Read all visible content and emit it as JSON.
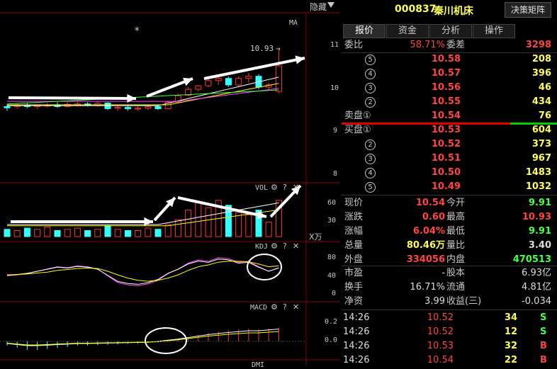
{
  "topbar": {
    "hide_label": "隐藏"
  },
  "header": {
    "code": "000837",
    "name": "秦川机床",
    "decision_button": "决策矩阵"
  },
  "tabs": [
    {
      "label": "报价",
      "active": true
    },
    {
      "label": "资金",
      "active": false
    },
    {
      "label": "分析",
      "active": false
    },
    {
      "label": "操作",
      "active": false
    }
  ],
  "weibi": {
    "label1": "委比",
    "pct": "58.71%",
    "label2": "委差",
    "diff": "3298"
  },
  "sell": [
    {
      "level": "⑤",
      "price": "10.58",
      "vol": "208"
    },
    {
      "level": "④",
      "price": "10.57",
      "vol": "396"
    },
    {
      "level": "③",
      "price": "10.56",
      "vol": "46"
    },
    {
      "level": "②",
      "price": "10.55",
      "vol": "434"
    },
    {
      "level": "卖盘①",
      "price": "10.54",
      "vol": "76"
    }
  ],
  "buy": [
    {
      "level": "买盘①",
      "price": "10.53",
      "vol": "604"
    },
    {
      "level": "②",
      "price": "10.52",
      "vol": "373"
    },
    {
      "level": "③",
      "price": "10.51",
      "vol": "967"
    },
    {
      "level": "④",
      "price": "10.50",
      "vol": "1483"
    },
    {
      "level": "⑤",
      "price": "10.49",
      "vol": "1032"
    }
  ],
  "quote": [
    {
      "l1": "现价",
      "v1": "10.54",
      "c1": "red",
      "l2": "今开",
      "v2": "9.91",
      "c2": "grn"
    },
    {
      "l1": "涨跌",
      "v1": "0.60",
      "c1": "red",
      "l2": "最高",
      "v2": "10.93",
      "c2": "red"
    },
    {
      "l1": "涨幅",
      "v1": "6.04%",
      "c1": "red",
      "l2": "最低",
      "v2": "9.91",
      "c2": "grn"
    },
    {
      "l1": "总量",
      "v1": "80.46万",
      "c1": "yel",
      "l2": "量比",
      "v2": "3.40",
      "c2": "wht"
    },
    {
      "l1": "外盘",
      "v1": "334056",
      "c1": "red",
      "l2": "内盘",
      "v2": "470513",
      "c2": "grn"
    }
  ],
  "fundamentals": [
    {
      "l1": "市盈",
      "v1": "-",
      "l2": "股本",
      "v2": "6.93亿"
    },
    {
      "l1": "换手",
      "v1": "16.71%",
      "l2": "流通",
      "v2": "4.81亿"
    },
    {
      "l1": "净资",
      "v1": "3.99",
      "l2": "收益(三)",
      "v2": "-0.034"
    }
  ],
  "ticks": [
    {
      "time": "14:26",
      "price": "10.52",
      "vol": "34",
      "side": "S"
    },
    {
      "time": "14:26",
      "price": "10.52",
      "vol": "12",
      "side": "S"
    },
    {
      "time": "14:26",
      "price": "10.53",
      "vol": "32",
      "side": "B"
    },
    {
      "time": "14:26",
      "price": "10.54",
      "vol": "22",
      "side": "B"
    }
  ],
  "chart": {
    "star": "*",
    "ma_label": "MA",
    "high_label": "10.93",
    "price_ticks": [
      "11",
      "10",
      "9",
      "8"
    ],
    "vol_label": "VOL",
    "vol_ticks": [
      "60",
      "30"
    ],
    "vol_unit": "X万",
    "kdj_label": "KDJ",
    "kdj_ticks": [
      "80",
      "40",
      "0"
    ],
    "macd_label": "MACD",
    "macd_ticks": [
      "0.2",
      "0.0"
    ],
    "next_label": "DMI"
  },
  "colors": {
    "up": "#ff3333",
    "down": "#33ffff",
    "ma5": "#ffffff",
    "ma10": "#ffff00",
    "ma20": "#ff44ff",
    "ma30": "#44ff44"
  }
}
